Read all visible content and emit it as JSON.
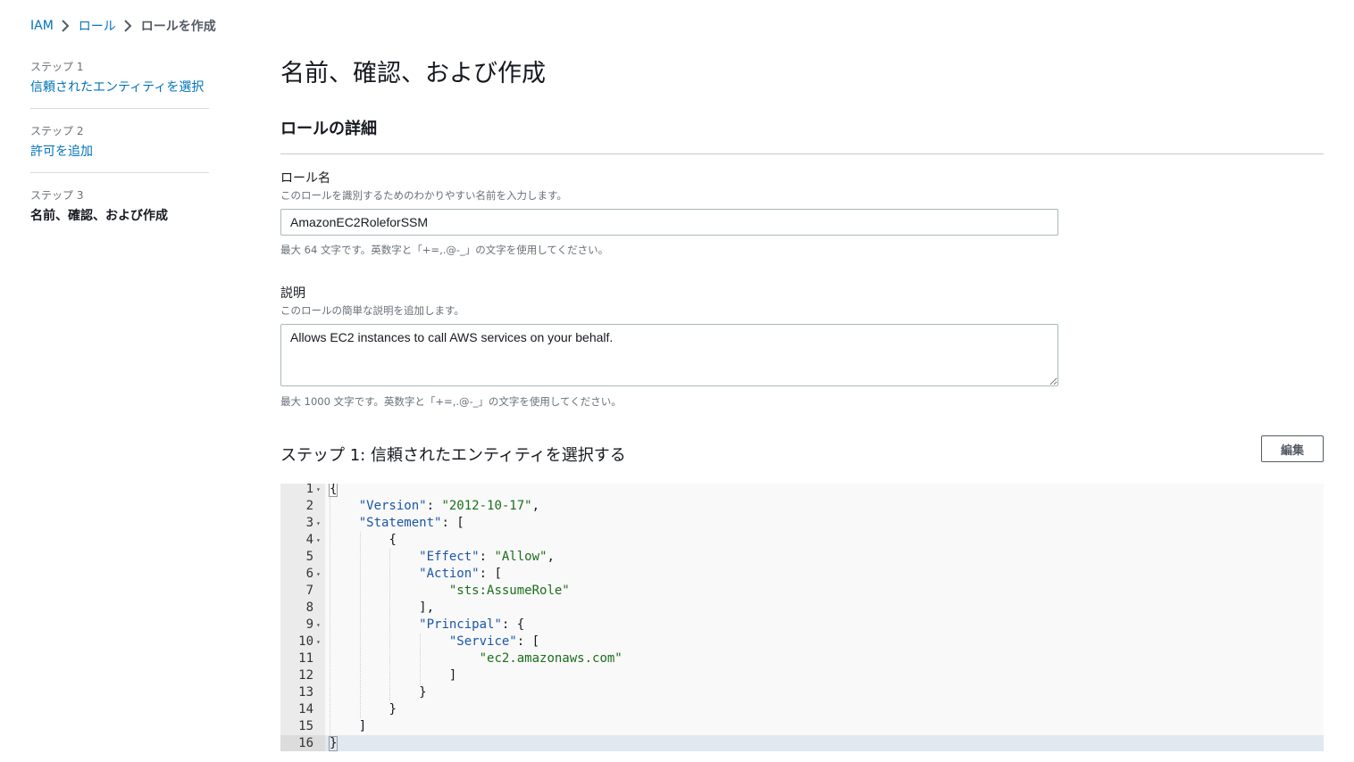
{
  "breadcrumb": {
    "items": [
      "IAM",
      "ロール"
    ],
    "current": "ロールを作成"
  },
  "steps": [
    {
      "num": "ステップ 1",
      "title": "信頼されたエンティティを選択"
    },
    {
      "num": "ステップ 2",
      "title": "許可を追加"
    },
    {
      "num": "ステップ 3",
      "title": "名前、確認、および作成"
    }
  ],
  "page": {
    "title": "名前、確認、および作成",
    "section_title": "ロールの詳細"
  },
  "role_name": {
    "label": "ロール名",
    "description": "このロールを識別するためのわかりやすい名前を入力します。",
    "value": "AmazonEC2RoleforSSM",
    "constraint": "最大 64 文字です。英数字と「+=,.@-_」の文字を使用してください。"
  },
  "description": {
    "label": "説明",
    "description": "このロールの簡単な説明を追加します。",
    "value": "Allows EC2 instances to call AWS services on your behalf.",
    "constraint": "最大 1000 文字です。英数字と「+=,.@-_」の文字を使用してください。"
  },
  "trust_step": {
    "title": "ステップ 1: 信頼されたエンティティを選択する",
    "edit_label": "編集"
  },
  "editor": {
    "lines": [
      {
        "n": "1",
        "fold": true,
        "indent": 0,
        "parts": [
          {
            "t": "p",
            "v": "{"
          }
        ]
      },
      {
        "n": "2",
        "fold": false,
        "indent": 1,
        "parts": [
          {
            "t": "k",
            "v": "\"Version\""
          },
          {
            "t": "p",
            "v": ": "
          },
          {
            "t": "s",
            "v": "\"2012-10-17\""
          },
          {
            "t": "p",
            "v": ","
          }
        ]
      },
      {
        "n": "3",
        "fold": true,
        "indent": 1,
        "parts": [
          {
            "t": "k",
            "v": "\"Statement\""
          },
          {
            "t": "p",
            "v": ": ["
          }
        ]
      },
      {
        "n": "4",
        "fold": true,
        "indent": 2,
        "parts": [
          {
            "t": "p",
            "v": "{"
          }
        ]
      },
      {
        "n": "5",
        "fold": false,
        "indent": 3,
        "parts": [
          {
            "t": "k",
            "v": "\"Effect\""
          },
          {
            "t": "p",
            "v": ": "
          },
          {
            "t": "s",
            "v": "\"Allow\""
          },
          {
            "t": "p",
            "v": ","
          }
        ]
      },
      {
        "n": "6",
        "fold": true,
        "indent": 3,
        "parts": [
          {
            "t": "k",
            "v": "\"Action\""
          },
          {
            "t": "p",
            "v": ": ["
          }
        ]
      },
      {
        "n": "7",
        "fold": false,
        "indent": 4,
        "parts": [
          {
            "t": "s",
            "v": "\"sts:AssumeRole\""
          }
        ]
      },
      {
        "n": "8",
        "fold": false,
        "indent": 3,
        "parts": [
          {
            "t": "p",
            "v": "],"
          }
        ]
      },
      {
        "n": "9",
        "fold": true,
        "indent": 3,
        "parts": [
          {
            "t": "k",
            "v": "\"Principal\""
          },
          {
            "t": "p",
            "v": ": {"
          }
        ]
      },
      {
        "n": "10",
        "fold": true,
        "indent": 4,
        "parts": [
          {
            "t": "k",
            "v": "\"Service\""
          },
          {
            "t": "p",
            "v": ": ["
          }
        ]
      },
      {
        "n": "11",
        "fold": false,
        "indent": 5,
        "parts": [
          {
            "t": "s",
            "v": "\"ec2.amazonaws.com\""
          }
        ]
      },
      {
        "n": "12",
        "fold": false,
        "indent": 4,
        "parts": [
          {
            "t": "p",
            "v": "]"
          }
        ]
      },
      {
        "n": "13",
        "fold": false,
        "indent": 3,
        "parts": [
          {
            "t": "p",
            "v": "}"
          }
        ]
      },
      {
        "n": "14",
        "fold": false,
        "indent": 2,
        "parts": [
          {
            "t": "p",
            "v": "}"
          }
        ]
      },
      {
        "n": "15",
        "fold": false,
        "indent": 1,
        "parts": [
          {
            "t": "p",
            "v": "]"
          }
        ]
      },
      {
        "n": "16",
        "fold": false,
        "indent": 0,
        "parts": [
          {
            "t": "p",
            "v": "}"
          }
        ],
        "active": true
      }
    ]
  }
}
